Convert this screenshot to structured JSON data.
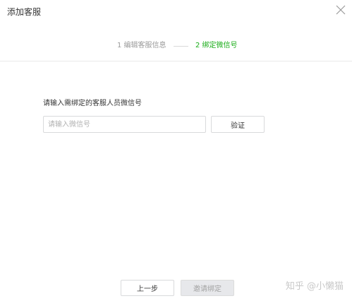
{
  "dialog": {
    "title": "添加客服",
    "close_icon": "close-icon"
  },
  "steps": [
    {
      "label": "1 编辑客服信息",
      "state": "done"
    },
    {
      "label": "2 绑定微信号",
      "state": "active"
    }
  ],
  "colors": {
    "active_step": "#1aad19",
    "inactive_step": "#9a9a9a",
    "disabled_button_bg": "#e7e8eb"
  },
  "form": {
    "label": "请输入需绑定的客服人员微信号",
    "input_value": "",
    "input_placeholder": "请输入微信号",
    "verify_label": "验证"
  },
  "footer": {
    "prev_label": "上一步",
    "invite_bind_label": "邀请绑定"
  },
  "watermark": "知乎 @小懒猫"
}
